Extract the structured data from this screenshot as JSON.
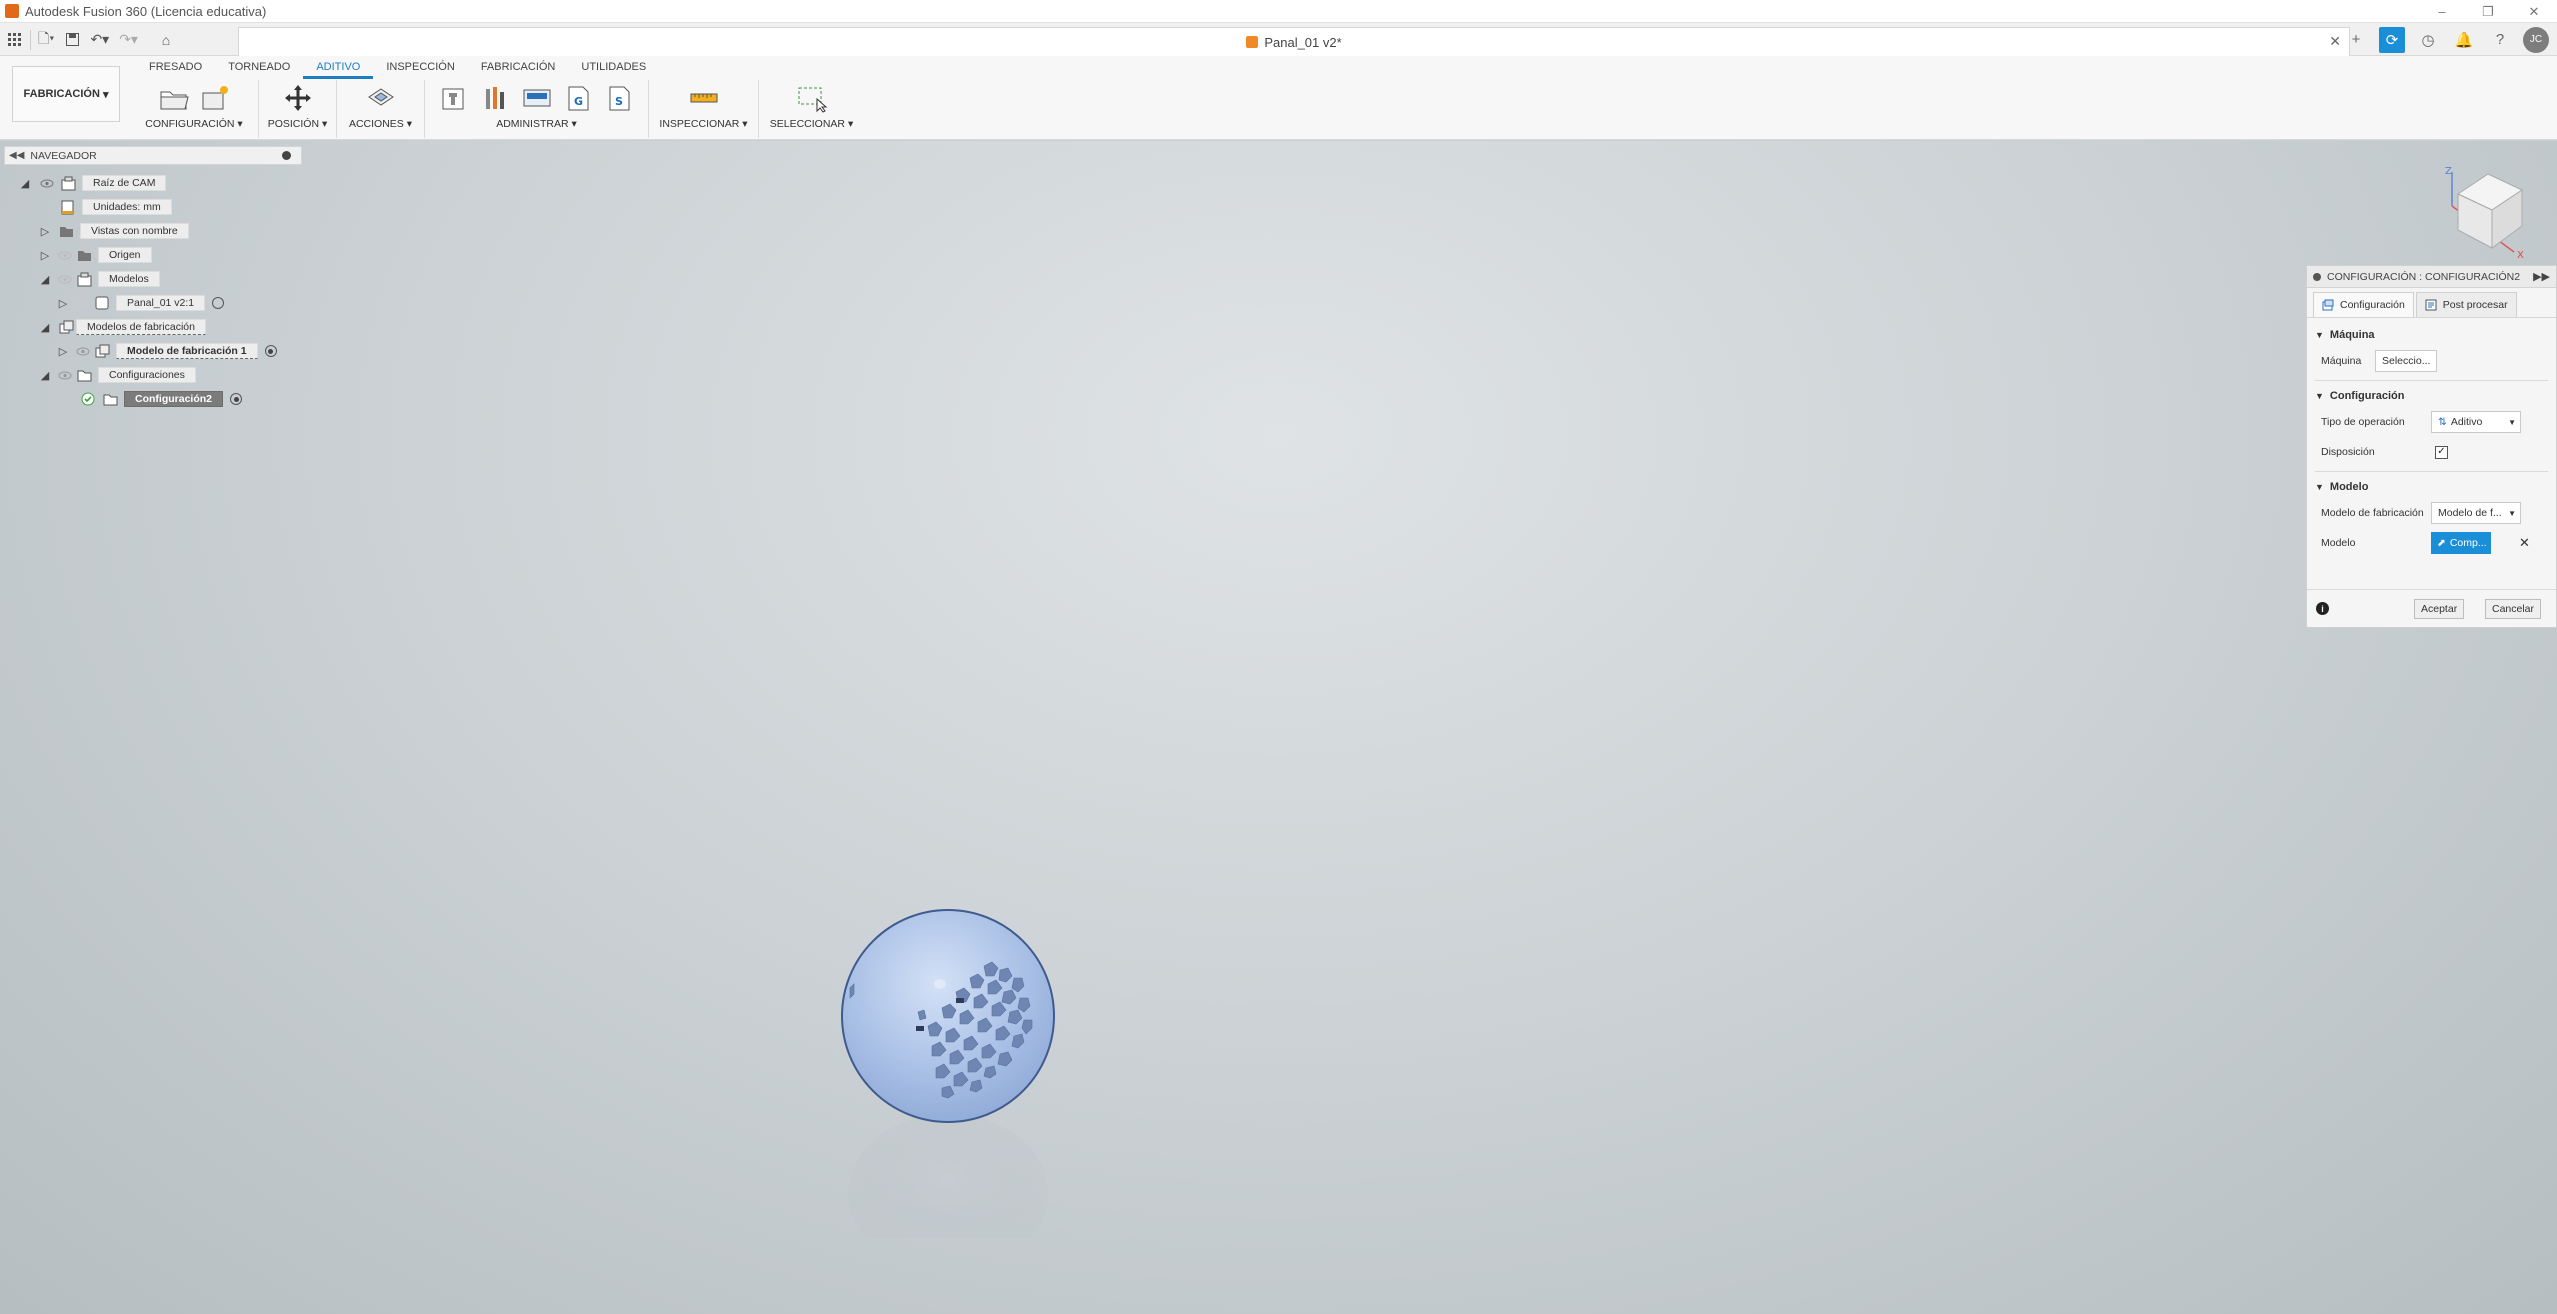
{
  "app": {
    "title": "Autodesk Fusion 360 (Licencia educativa)"
  },
  "document": {
    "tab_title": "Panal_01 v2*"
  },
  "ribbon": {
    "workspace": "FABRICACIÓN",
    "tabs": [
      {
        "label": "FRESADO"
      },
      {
        "label": "TORNEADO"
      },
      {
        "label": "ADITIVO",
        "active": true
      },
      {
        "label": "INSPECCIÓN"
      },
      {
        "label": "FABRICACIÓN"
      },
      {
        "label": "UTILIDADES"
      }
    ],
    "groups": {
      "configuracion": "CONFIGURACIÓN",
      "posicion": "POSICIÓN",
      "acciones": "ACCIONES",
      "administrar": "ADMINISTRAR",
      "inspeccionar": "INSPECCIONAR",
      "seleccionar": "SELECCIONAR"
    }
  },
  "navigator": {
    "title": "NAVEGADOR",
    "items": {
      "cam_root": "Raíz de CAM",
      "units": "Unidades: mm",
      "named_views": "Vistas con nombre",
      "origin": "Origen",
      "models": "Modelos",
      "panal": "Panal_01 v2:1",
      "mfg_models": "Modelos de fabricación",
      "mfg_model_1": "Modelo de fabricación 1",
      "setups": "Configuraciones",
      "setup2": "Configuración2"
    }
  },
  "viewcube": {
    "axis_z": "Z",
    "axis_x": "X"
  },
  "config_panel": {
    "title": "CONFIGURACIÓN : CONFIGURACIÓN2",
    "tabs": {
      "config": "Configuración",
      "post": "Post procesar"
    },
    "machine_section": "Máquina",
    "machine_label": "Máquina",
    "machine_button": "Seleccio...",
    "config_section": "Configuración",
    "op_type_label": "Tipo de operación",
    "op_type_value": "Aditivo",
    "disposition_label": "Disposición",
    "disposition_checked": true,
    "model_section": "Modelo",
    "mfg_model_label": "Modelo de fabricación",
    "mfg_model_value": "Modelo de f...",
    "model_label": "Modelo",
    "model_button": "Comp...",
    "accept": "Aceptar",
    "cancel": "Cancelar"
  },
  "colors": {
    "accent": "#1c7fc4",
    "select_blue": "#1a8fd8",
    "sphere": "#a9c0e6"
  }
}
